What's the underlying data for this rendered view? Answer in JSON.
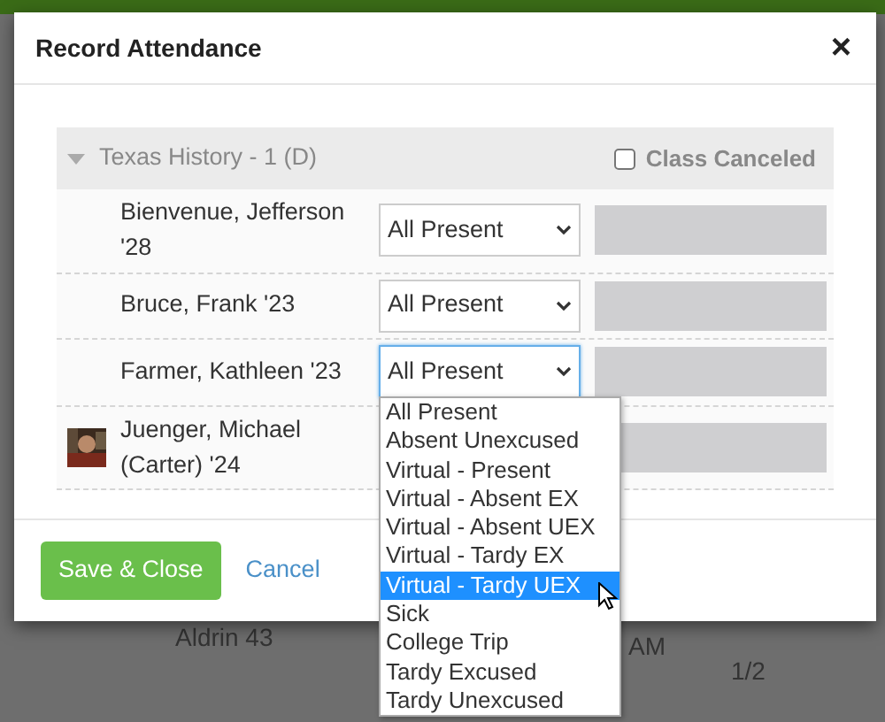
{
  "background": {
    "texts": [
      "Aldrin 43",
      "AM",
      "1/2"
    ]
  },
  "modal": {
    "title": "Record Attendance",
    "close": "×",
    "section": {
      "title": "Texas History - 1 (D)",
      "expanded": true,
      "class_canceled": {
        "label": "Class Canceled",
        "checked": false
      }
    },
    "students": [
      {
        "name": "Bienvenue, Jefferson '28",
        "status": "All Present",
        "has_photo": false,
        "dropdown_open": false
      },
      {
        "name": "Bruce, Frank '23",
        "status": "All Present",
        "has_photo": false,
        "dropdown_open": false
      },
      {
        "name": "Farmer, Kathleen '23",
        "status": "All Present",
        "has_photo": false,
        "dropdown_open": true
      },
      {
        "name": "Juenger, Michael (Carter) '24",
        "has_photo": true
      }
    ],
    "dropdown_options": [
      {
        "label": "All Present",
        "selected": false
      },
      {
        "label": "Absent Unexcused",
        "selected": false
      },
      {
        "label": "Virtual - Present",
        "selected": false
      },
      {
        "label": "Virtual - Absent EX",
        "selected": false
      },
      {
        "label": "Virtual - Absent UEX",
        "selected": false
      },
      {
        "label": "Virtual - Tardy EX",
        "selected": false
      },
      {
        "label": "Virtual - Tardy UEX",
        "selected": true
      },
      {
        "label": "Sick",
        "selected": false
      },
      {
        "label": "College Trip",
        "selected": false
      },
      {
        "label": "Tardy Excused",
        "selected": false
      },
      {
        "label": "Tardy Unexcused",
        "selected": false
      }
    ],
    "buttons": {
      "primary": "Save & Close",
      "secondary": "Cancel"
    }
  }
}
